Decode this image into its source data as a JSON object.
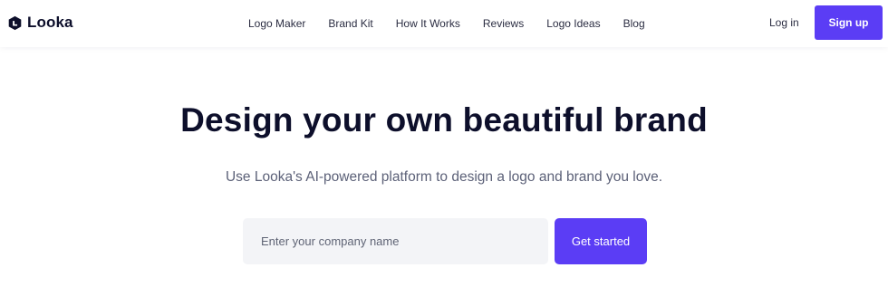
{
  "header": {
    "brand_name": "Looka",
    "nav_items": [
      {
        "label": "Logo Maker"
      },
      {
        "label": "Brand Kit"
      },
      {
        "label": "How It Works"
      },
      {
        "label": "Reviews"
      },
      {
        "label": "Logo Ideas"
      },
      {
        "label": "Blog"
      }
    ],
    "login_label": "Log in",
    "signup_label": "Sign up"
  },
  "hero": {
    "title": "Design your own beautiful brand",
    "subtitle": "Use Looka's AI-powered platform to design a logo and brand you love.",
    "input": {
      "value": "",
      "placeholder": "Enter your company name"
    },
    "cta_label": "Get started"
  },
  "colors": {
    "accent": "#5b3df5",
    "text_dark": "#0d0f2b",
    "text_muted": "#5c6178",
    "input_bg": "#f3f4f7"
  },
  "icons": {
    "brand_logo": "looka-logo-icon"
  }
}
